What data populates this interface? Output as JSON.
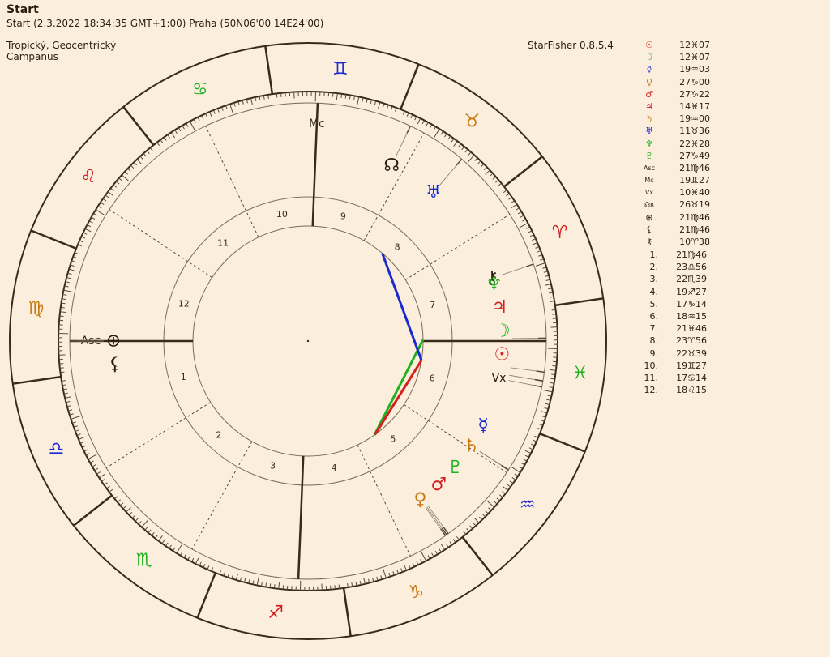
{
  "header": {
    "title": "Start",
    "subtitle": "Start (2.3.2022 18:34:35 GMT+1:00) Praha (50N06'00 14E24'00)",
    "zodiac": "Tropický, Geocentrický",
    "house_system": "Campanus",
    "app": "StarFisher 0.8.5.4"
  },
  "colors": {
    "background": "#fbeedd",
    "line": "#3a2a1a",
    "fire": "#d42020",
    "earth": "#c87a10",
    "air": "#1a2ad0",
    "water": "#20b020"
  },
  "signs": [
    {
      "name": "aries",
      "glyph": "♈",
      "element": "fire",
      "start": 0
    },
    {
      "name": "taurus",
      "glyph": "♉",
      "element": "earth",
      "start": 30
    },
    {
      "name": "gemini",
      "glyph": "♊",
      "element": "air",
      "start": 60
    },
    {
      "name": "cancer",
      "glyph": "♋",
      "element": "water",
      "start": 90
    },
    {
      "name": "leo",
      "glyph": "♌",
      "element": "fire",
      "start": 120
    },
    {
      "name": "virgo",
      "glyph": "♍",
      "element": "earth",
      "start": 150
    },
    {
      "name": "libra",
      "glyph": "♎",
      "element": "air",
      "start": 180
    },
    {
      "name": "scorpio",
      "glyph": "♏",
      "element": "water",
      "start": 210
    },
    {
      "name": "sagittarius",
      "glyph": "♐",
      "element": "fire",
      "start": 240
    },
    {
      "name": "capricorn",
      "glyph": "♑",
      "element": "earth",
      "start": 270
    },
    {
      "name": "aquarius",
      "glyph": "♒",
      "element": "air",
      "start": 300
    },
    {
      "name": "pisces",
      "glyph": "♓",
      "element": "water",
      "start": 330
    }
  ],
  "planets": [
    {
      "name": "sun",
      "glyph": "☉",
      "position": "12♓07",
      "color": "#d42020"
    },
    {
      "name": "moon",
      "glyph": "☽",
      "position": "12♓07",
      "color": "#20b020"
    },
    {
      "name": "mercury",
      "glyph": "☿",
      "position": "19♒03",
      "color": "#1a2ad0"
    },
    {
      "name": "venus",
      "glyph": "♀",
      "position": "27♑00",
      "color": "#c87a10"
    },
    {
      "name": "mars",
      "glyph": "♂",
      "position": "27♑22",
      "color": "#d42020"
    },
    {
      "name": "jupiter",
      "glyph": "♃",
      "position": "14♓17",
      "color": "#d42020"
    },
    {
      "name": "saturn",
      "glyph": "♄",
      "position": "19♒00",
      "color": "#c87a10"
    },
    {
      "name": "uranus",
      "glyph": "♅",
      "position": "11♉36",
      "color": "#1a2ad0"
    },
    {
      "name": "neptune",
      "glyph": "♆",
      "position": "22♓28",
      "color": "#20b020"
    },
    {
      "name": "pluto",
      "glyph": "♇",
      "position": "27♑49",
      "color": "#20b020"
    },
    {
      "name": "ascendant",
      "glyph": "Asc",
      "position": "21♍46",
      "color": "#2a1d12"
    },
    {
      "name": "midheaven",
      "glyph": "Mc",
      "position": "19♊27",
      "color": "#2a1d12"
    },
    {
      "name": "vertex",
      "glyph": "Vx",
      "position": "10♓40",
      "color": "#2a1d12"
    },
    {
      "name": "north-node",
      "glyph": "☊ʀ",
      "position": "26♉19",
      "color": "#2a1d12"
    },
    {
      "name": "part-of-fortune",
      "glyph": "⊕",
      "position": "21♍46",
      "color": "#2a1d12"
    },
    {
      "name": "lilith",
      "glyph": "⚸",
      "position": "21♍46",
      "color": "#2a1d12"
    },
    {
      "name": "chiron",
      "glyph": "⚷",
      "position": "10♈38",
      "color": "#2a1d12"
    }
  ],
  "houses": [
    {
      "n": "1.",
      "position": "21♍46"
    },
    {
      "n": "2.",
      "position": "23♎56"
    },
    {
      "n": "3.",
      "position": "22♏39"
    },
    {
      "n": "4.",
      "position": "19♐27"
    },
    {
      "n": "5.",
      "position": "17♑14"
    },
    {
      "n": "6.",
      "position": "18♒15"
    },
    {
      "n": "7.",
      "position": "21♓46"
    },
    {
      "n": "8.",
      "position": "23♈56"
    },
    {
      "n": "9.",
      "position": "22♉39"
    },
    {
      "n": "10.",
      "position": "19♊27"
    },
    {
      "n": "11.",
      "position": "17♋14"
    },
    {
      "n": "12.",
      "position": "18♌15"
    }
  ],
  "house_numbers": [
    "1",
    "2",
    "3",
    "4",
    "5",
    "6",
    "7",
    "8",
    "9",
    "10",
    "11",
    "12"
  ],
  "wheel_points": [
    {
      "name": "sun",
      "glyph": "☉",
      "lon": 342.12,
      "color": "#d42020"
    },
    {
      "name": "moon",
      "glyph": "☽",
      "lon": 342.12,
      "color": "#20b020"
    },
    {
      "name": "mercury",
      "glyph": "☿",
      "lon": 319.05,
      "color": "#1a2ad0"
    },
    {
      "name": "venus",
      "glyph": "♀",
      "lon": 297.0,
      "color": "#c87a10"
    },
    {
      "name": "mars",
      "glyph": "♂",
      "lon": 297.37,
      "color": "#d42020"
    },
    {
      "name": "jupiter",
      "glyph": "♃",
      "lon": 344.28,
      "color": "#d42020"
    },
    {
      "name": "saturn",
      "glyph": "♄",
      "lon": 319.0,
      "color": "#c87a10"
    },
    {
      "name": "uranus",
      "glyph": "♅",
      "lon": 41.6,
      "color": "#1a2ad0"
    },
    {
      "name": "neptune",
      "glyph": "♆",
      "lon": 352.47,
      "color": "#20b020"
    },
    {
      "name": "pluto",
      "glyph": "♇",
      "lon": 297.82,
      "color": "#20b020"
    },
    {
      "name": "vertex",
      "glyph": "Vx",
      "lon": 340.67,
      "color": "#2a1d12"
    },
    {
      "name": "north-node",
      "glyph": "☊",
      "lon": 56.32,
      "color": "#2a1d12"
    },
    {
      "name": "chiron",
      "glyph": "⚷",
      "lon": 10.63,
      "color": "#2a1d12"
    },
    {
      "name": "part-of-fortune",
      "glyph": "⊕",
      "lon": 171.77,
      "color": "#2a1d12"
    },
    {
      "name": "lilith",
      "glyph": "⚸",
      "lon": 171.77,
      "color": "#2a1d12"
    }
  ],
  "axis_labels": {
    "asc": "Asc",
    "mc": "Mc"
  },
  "cusps_lon": [
    171.77,
    203.93,
    232.65,
    259.45,
    287.23,
    318.25,
    351.77,
    23.93,
    52.65,
    79.45,
    107.23,
    138.25
  ],
  "aspects": [
    {
      "from": "venus",
      "to": "neptune",
      "color": "#20b020"
    },
    {
      "from": "mars",
      "to": "sun",
      "color": "#d42020"
    },
    {
      "from": "uranus",
      "to": "sun",
      "color": "#1a2ad0"
    }
  ]
}
